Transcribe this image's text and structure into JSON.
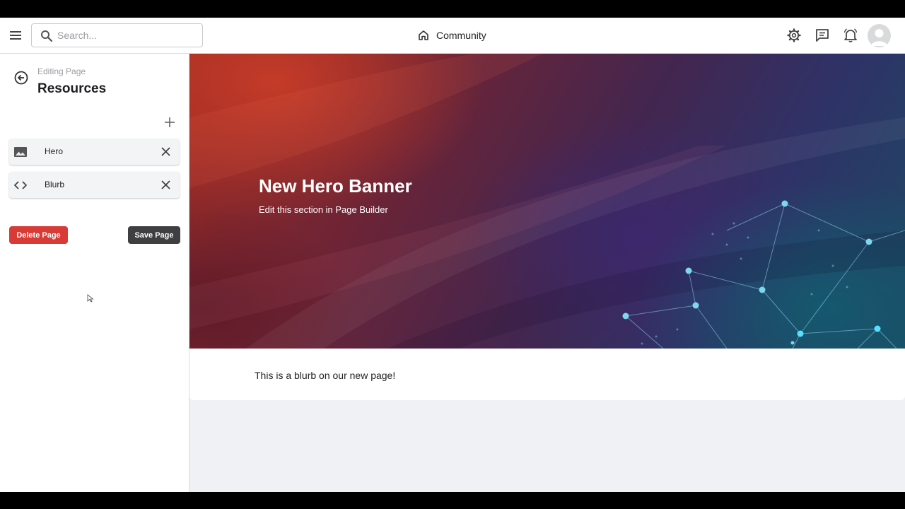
{
  "topbar": {
    "search_placeholder": "Search...",
    "breadcrumb_label": "Community",
    "icons": [
      "menu-icon",
      "search-icon",
      "home-icon",
      "settings-icon",
      "chat-icon",
      "notification-bell-icon",
      "avatar-icon"
    ]
  },
  "sidebar": {
    "subtitle": "Editing Page",
    "title": "Resources",
    "blocks": [
      {
        "label": "Hero",
        "icon": "image-icon"
      },
      {
        "label": "Blurb",
        "icon": "code-icon"
      }
    ],
    "delete_label": "Delete Page",
    "save_label": "Save Page"
  },
  "hero": {
    "title": "New Hero Banner",
    "subtitle": "Edit this section in Page Builder"
  },
  "blurb": {
    "text": "This is a blurb on our new page!"
  },
  "colors": {
    "delete_button": "#d83a36",
    "save_button": "#3f3f41",
    "network_node": "#7fd6ef"
  }
}
